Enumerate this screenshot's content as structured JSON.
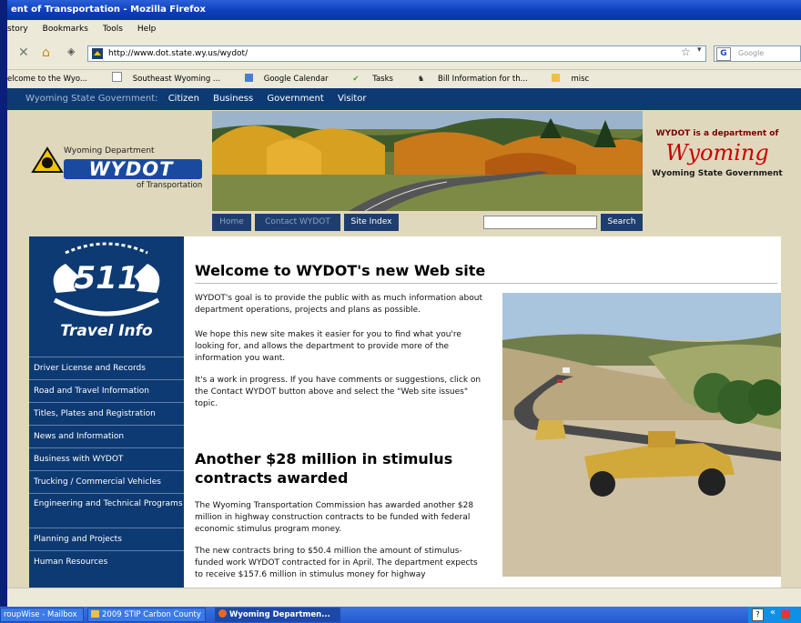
{
  "window": {
    "title": "ent of Transportation - Mozilla Firefox"
  },
  "menu": {
    "items": [
      "story",
      "Bookmarks",
      "Tools",
      "Help"
    ]
  },
  "browser": {
    "url": "http://www.dot.state.wy.us/wydot/",
    "search_placeholder": "Google",
    "bookmarks": [
      "elcome to the Wyo...",
      "Southeast Wyoming ...",
      "Google Calendar",
      "Tasks",
      "Bill Information for th...",
      "misc"
    ]
  },
  "site": {
    "gov_bar": {
      "label": "Wyoming State Government:",
      "links": [
        "Citizen",
        "Business",
        "Government",
        "Visitor"
      ]
    },
    "logo": {
      "line1": "Wyoming Department",
      "name": "WYDOT",
      "line2": "of Transportation"
    },
    "state_block": {
      "line1": "WYDOT is a department of",
      "script": "Wyoming",
      "line2": "Wyoming State Government"
    },
    "tabs": [
      "Home",
      "Contact WYDOT",
      "Site Index"
    ],
    "search_button": "Search",
    "sidebar": {
      "badge": "511",
      "badge_caption": "Travel Info",
      "items": [
        "Driver License and Records",
        "Road and Travel Information",
        "Titles, Plates and Registration",
        "News and Information",
        "Business with WYDOT",
        "Trucking / Commercial Vehicles",
        "Engineering and Technical Programs",
        "Planning and Projects",
        "Human Resources"
      ]
    },
    "main": {
      "heading": "Welcome to WYDOT's new Web site",
      "paragraphs": [
        "WYDOT's goal is to provide the public with as much information about department operations, projects and plans as possible.",
        "We hope this new site makes it easier for you to find what you're looking for, and allows the department to provide more of the information you want.",
        "It's a work in progress. If you have comments or suggestions, click on the Contact WYDOT button above and select the \"Web site issues\" topic."
      ],
      "heading2": "Another $28 million in stimulus contracts awarded",
      "paragraphs2": [
        "The Wyoming Transportation Commission has awarded another $28 million in highway construction contracts to be funded with federal economic stimulus program money.",
        "The new contracts bring to $50.4 million the amount of stimulus-funded work WYDOT contracted for in April. The department expects to receive $157.6 million in stimulus money for highway"
      ]
    }
  },
  "taskbar": {
    "items": [
      "roupWise - Mailbox",
      "2009 STIP Carbon County",
      "Wyoming Departmen..."
    ]
  }
}
